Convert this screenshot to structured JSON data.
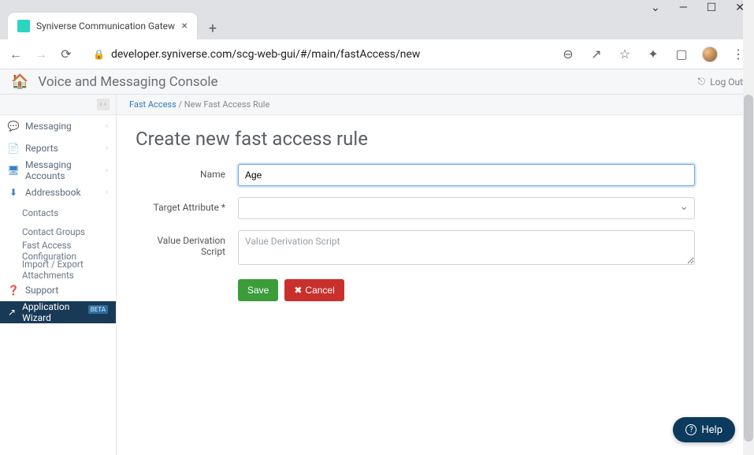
{
  "browser": {
    "tab_title": "Syniverse Communication Gatew",
    "url": "developer.syniverse.com/scg-web-gui/#/main/fastAccess/new",
    "win_controls": {
      "dropdown": "⌄",
      "minimize": "—",
      "maximize": "☐",
      "close": "✕"
    },
    "new_tab": "+",
    "tab_close": "×",
    "nav": {
      "back": "←",
      "forward": "→",
      "reload": "⟳"
    },
    "right_icons": {
      "zoom": "⊖",
      "share": "↗",
      "star": "☆",
      "ext": "✦",
      "panel": "▢",
      "menu": "⋮"
    }
  },
  "app": {
    "title": "Voice and Messaging Console",
    "logout": "Log Out"
  },
  "sidebar": {
    "toggle": "‹ ›",
    "items": [
      {
        "icon": "💬",
        "label": "Messaging",
        "expandable": true
      },
      {
        "icon": "📄",
        "label": "Reports",
        "expandable": true
      },
      {
        "icon": "🖥",
        "label": "Messaging Accounts",
        "expandable": true
      },
      {
        "icon": "⬇",
        "label": "Addressbook",
        "expandable": true,
        "children": [
          "Contacts",
          "Contact Groups",
          "Fast Access Configuration",
          "Import / Export Attachments"
        ]
      },
      {
        "icon": "❓",
        "label": "Support"
      },
      {
        "icon": "↗",
        "label": "Application Wizard",
        "badge": "BETA",
        "active": true
      }
    ]
  },
  "breadcrumb": {
    "root": "Fast Access",
    "sep": "/",
    "current": "New Fast Access Rule"
  },
  "page": {
    "title": "Create new fast access rule",
    "fields": {
      "name_label": "Name",
      "name_value": "Age",
      "target_label": "Target Attribute *",
      "target_value": "",
      "script_label": "Value Derivation Script",
      "script_placeholder": "Value Derivation Script",
      "script_value": ""
    },
    "buttons": {
      "save": "Save",
      "cancel": "Cancel",
      "cancel_icon": "✖"
    }
  },
  "help": {
    "label": "Help",
    "icon": "?"
  }
}
